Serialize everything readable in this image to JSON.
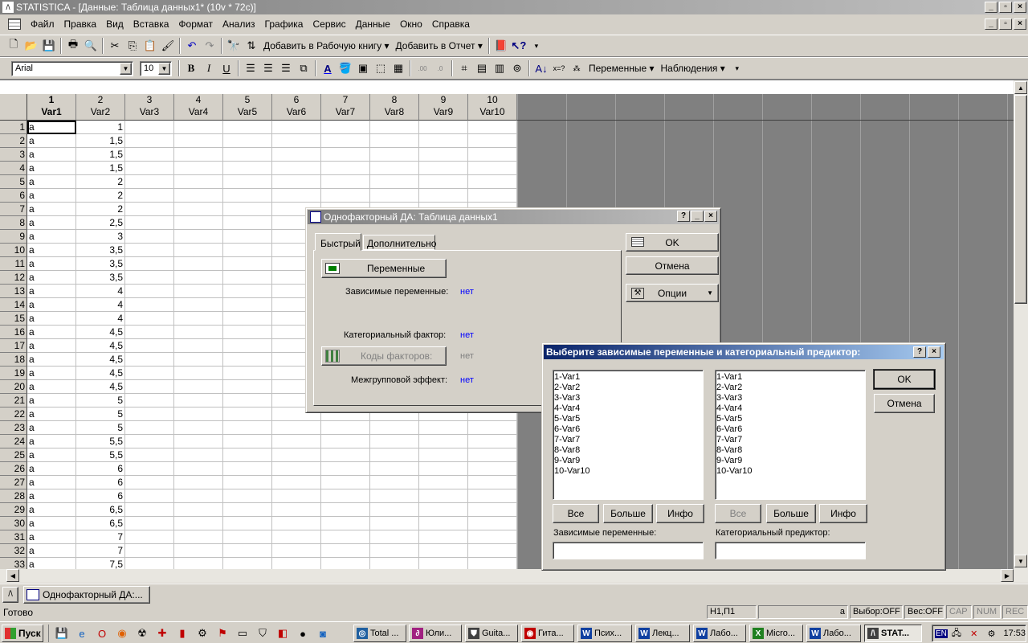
{
  "window_title": "STATISTICA - [Данные: Таблица данных1* (10v * 72c)]",
  "menu": [
    "Файл",
    "Правка",
    "Вид",
    "Вставка",
    "Формат",
    "Анализ",
    "Графика",
    "Сервис",
    "Данные",
    "Окно",
    "Справка"
  ],
  "toolbar1": {
    "add_workbook": "Добавить в Рабочую книгу",
    "add_report": "Добавить в Отчет"
  },
  "toolbar2": {
    "font_name": "Arial",
    "font_size": "10",
    "variables": "Переменные",
    "observations": "Наблюдения"
  },
  "grid": {
    "columns": [
      {
        "num": "1",
        "name": "Var1"
      },
      {
        "num": "2",
        "name": "Var2"
      },
      {
        "num": "3",
        "name": "Var3"
      },
      {
        "num": "4",
        "name": "Var4"
      },
      {
        "num": "5",
        "name": "Var5"
      },
      {
        "num": "6",
        "name": "Var6"
      },
      {
        "num": "7",
        "name": "Var7"
      },
      {
        "num": "8",
        "name": "Var8"
      },
      {
        "num": "9",
        "name": "Var9"
      },
      {
        "num": "10",
        "name": "Var10"
      }
    ],
    "rows": [
      [
        "1",
        "a",
        "1"
      ],
      [
        "2",
        "a",
        "1,5"
      ],
      [
        "3",
        "a",
        "1,5"
      ],
      [
        "4",
        "a",
        "1,5"
      ],
      [
        "5",
        "a",
        "2"
      ],
      [
        "6",
        "a",
        "2"
      ],
      [
        "7",
        "a",
        "2"
      ],
      [
        "8",
        "a",
        "2,5"
      ],
      [
        "9",
        "a",
        "3"
      ],
      [
        "10",
        "a",
        "3,5"
      ],
      [
        "11",
        "a",
        "3,5"
      ],
      [
        "12",
        "a",
        "3,5"
      ],
      [
        "13",
        "a",
        "4"
      ],
      [
        "14",
        "a",
        "4"
      ],
      [
        "15",
        "a",
        "4"
      ],
      [
        "16",
        "a",
        "4,5"
      ],
      [
        "17",
        "a",
        "4,5"
      ],
      [
        "18",
        "a",
        "4,5"
      ],
      [
        "19",
        "a",
        "4,5"
      ],
      [
        "20",
        "a",
        "4,5"
      ],
      [
        "21",
        "a",
        "5"
      ],
      [
        "22",
        "a",
        "5"
      ],
      [
        "23",
        "a",
        "5"
      ],
      [
        "24",
        "a",
        "5,5"
      ],
      [
        "25",
        "a",
        "5,5"
      ],
      [
        "26",
        "a",
        "6"
      ],
      [
        "27",
        "a",
        "6"
      ],
      [
        "28",
        "a",
        "6"
      ],
      [
        "29",
        "a",
        "6,5"
      ],
      [
        "30",
        "a",
        "6,5"
      ],
      [
        "31",
        "a",
        "7"
      ],
      [
        "32",
        "a",
        "7"
      ],
      [
        "33",
        "a",
        "7,5"
      ]
    ]
  },
  "anova_dialog": {
    "title": "Однофакторный ДА: Таблица данных1",
    "tab_quick": "Быстрый",
    "tab_advanced": "Дополнительно",
    "variables_button": "Переменные",
    "dependent_label": "Зависимые переменные:",
    "dependent_value": "нет",
    "factor_label": "Категориальный фактор:",
    "factor_value": "нет",
    "codes_button": "Коды факторов:",
    "codes_value": "нет",
    "effect_label": "Межгрупповой эффект:",
    "effect_value": "нет",
    "ok": "OK",
    "cancel": "Отмена",
    "options": "Опции"
  },
  "select_dialog": {
    "title": "Выберите зависимые переменные и категориальный предиктор:",
    "list": [
      "1-Var1",
      "2-Var2",
      "3-Var3",
      "4-Var4",
      "5-Var5",
      "6-Var6",
      "7-Var7",
      "8-Var8",
      "9-Var9",
      "10-Var10"
    ],
    "all": "Все",
    "more": "Больше",
    "info": "Инфо",
    "dependent_label": "Зависимые переменные:",
    "predictor_label": "Категориальный предиктор:",
    "ok": "OK",
    "cancel": "Отмена"
  },
  "window_tab": "Однофакторный ДА:...",
  "status": {
    "ready": "Готово",
    "cell": "Н1,П1",
    "value": "a",
    "select": "Выбор:OFF",
    "weight": "Вес:OFF",
    "caps": "CAP",
    "num": "NUM",
    "rec": "REC"
  },
  "taskbar": {
    "start": "Пуск",
    "tasks": [
      "Total ...",
      "Юли...",
      "Guita...",
      "Гита...",
      "Псих...",
      "Лекц...",
      "Лабо...",
      "Micro...",
      "Лабо...",
      "STAT..."
    ],
    "lang": "EN",
    "clock": "17:53"
  }
}
